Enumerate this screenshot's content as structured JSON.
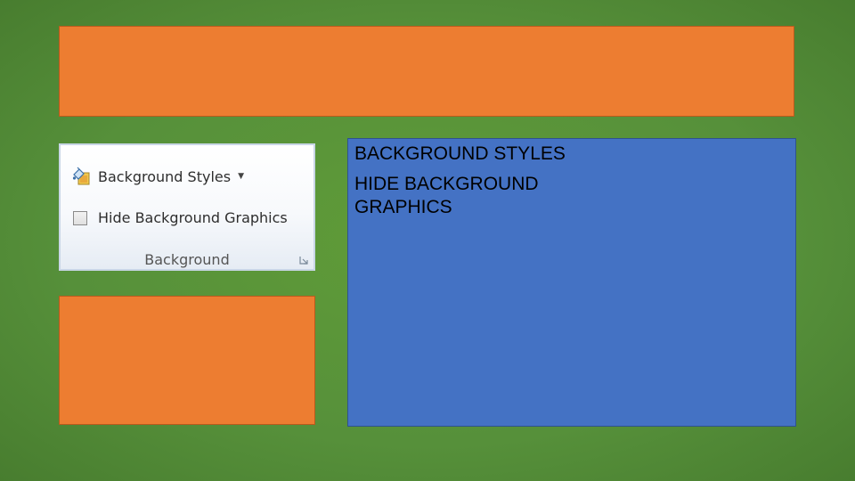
{
  "ribbon": {
    "styles_label": "Background Styles",
    "hide_label": "Hide Background Graphics",
    "group_label": "Background",
    "styles_icon": "paint-bucket-icon",
    "dropdown_icon": "dropdown-arrow-icon",
    "launcher_icon": "dialog-launcher-icon",
    "hide_checked": false
  },
  "content": {
    "bullets": [
      "BACKGROUND STYLES",
      "HIDE BACKGROUND GRAPHICS"
    ]
  },
  "colors": {
    "background": "#5a943a",
    "accent_orange": "#ed7d31",
    "accent_blue": "#4472c4"
  }
}
